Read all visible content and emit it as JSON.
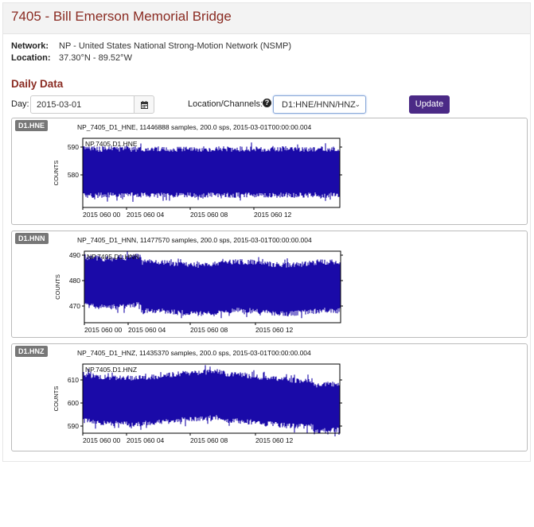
{
  "page": {
    "title": "7405 - Bill Emerson Memorial Bridge"
  },
  "info": {
    "network_label": "Network:",
    "network_value": "NP - United States National Strong-Motion Network (NSMP)",
    "location_label": "Location:",
    "location_value": "37.30°N - 89.52°W"
  },
  "daily": {
    "title": "Daily Data",
    "day_label": "Day:",
    "day_value": "2015-03-01",
    "calendar_icon": "calendar-icon",
    "loc_label": "Location/Channels:",
    "help_icon": "question-circle-icon",
    "loc_value": "D1:HNE/HNN/HNZ",
    "update_label": "Update"
  },
  "plots": [
    {
      "badge": "D1.HNE",
      "header": "NP_7405_D1_HNE, 11446888 samples, 200.0 sps, 2015-03-01T00:00:00.004",
      "inset": "NP.7405.D1.HNE",
      "ylabel": "COUNTS",
      "yticks": [
        "590",
        "580"
      ],
      "xticks": [
        "2015 060 00",
        "2015 060 04",
        "2015 060 08",
        "2015 060 12"
      ],
      "color": "#1a0aa8"
    },
    {
      "badge": "D1.HNN",
      "header": "NP_7405_D1_HNN, 11477570 samples, 200.0 sps, 2015-03-01T00:00:00.004",
      "inset": "NP.7405.D1.HNN",
      "ylabel": "COUNTS",
      "yticks": [
        "490",
        "480",
        "470"
      ],
      "xticks": [
        "2015 060 00",
        "2015 060 04",
        "2015 060 08",
        "2015 060 12"
      ],
      "color": "#1a0aa8"
    },
    {
      "badge": "D1.HNZ",
      "header": "NP_7405_D1_HNZ, 11435370 samples, 200.0 sps, 2015-03-01T00:00:00.004",
      "inset": "NP.7405.D1.HNZ",
      "ylabel": "COUNTS",
      "yticks": [
        "610",
        "600",
        "590"
      ],
      "xticks": [
        "2015 060 00",
        "2015 060 04",
        "2015 060 08",
        "2015 060 12"
      ],
      "color": "#1a0aa8"
    }
  ]
}
